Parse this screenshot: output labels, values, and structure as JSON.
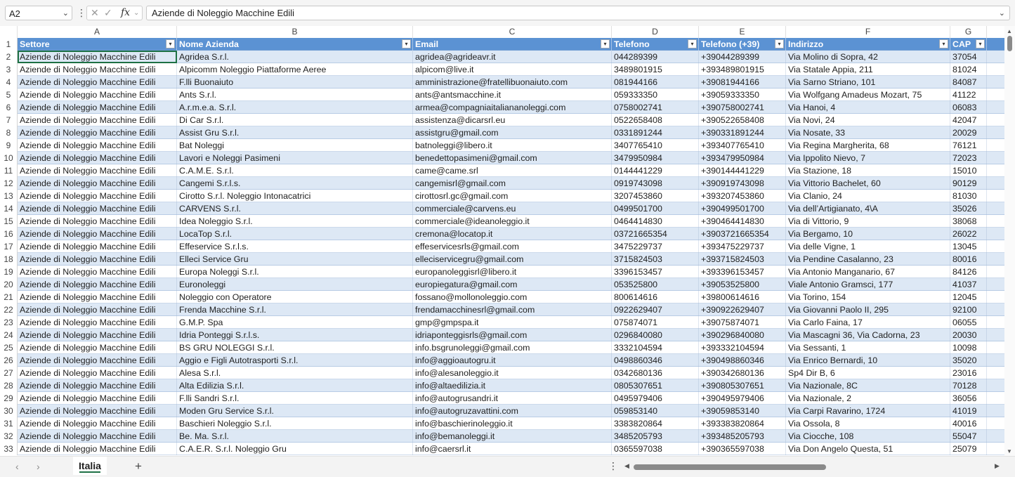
{
  "formula_bar": {
    "name_box": "A2",
    "formula": "Aziende di Noleggio Macchine Edili"
  },
  "columns": [
    "A",
    "B",
    "C",
    "D",
    "E",
    "F",
    "G"
  ],
  "header_row_number": "1",
  "headers": [
    "Settore",
    "Nome Azienda",
    "Email",
    "Telefono",
    "Telefono (+39)",
    "Indirizzo",
    "CAP"
  ],
  "rows": [
    {
      "n": "2",
      "cells": [
        "Aziende di Noleggio Macchine Edili",
        "Agridea S.r.l.",
        "agridea@agrideavr.it",
        "044289399",
        "+39044289399",
        "Via Molino di Sopra, 42",
        "37054"
      ]
    },
    {
      "n": "3",
      "cells": [
        "Aziende di Noleggio Macchine Edili",
        "Alpicomm Noleggio Piattaforme Aeree",
        "alpicom@live.it",
        "3489801915",
        "+393489801915",
        "Via Statale Appia, 211",
        "81024"
      ]
    },
    {
      "n": "4",
      "cells": [
        "Aziende di Noleggio Macchine Edili",
        "F.lli Buonaiuto",
        "amministrazione@fratellibuonaiuto.com",
        "081944166",
        "+39081944166",
        "Via Sarno Striano, 101",
        "84087"
      ]
    },
    {
      "n": "5",
      "cells": [
        "Aziende di Noleggio Macchine Edili",
        "Ants S.r.l.",
        "ants@antsmacchine.it",
        "059333350",
        "+39059333350",
        "Via Wolfgang Amadeus Mozart, 75",
        "41122"
      ]
    },
    {
      "n": "6",
      "cells": [
        "Aziende di Noleggio Macchine Edili",
        "A.r.m.e.a. S.r.l.",
        "armea@compagniaitaliananoleggi.com",
        "0758002741",
        "+390758002741",
        "Via Hanoi, 4",
        "06083"
      ]
    },
    {
      "n": "7",
      "cells": [
        "Aziende di Noleggio Macchine Edili",
        "Di Car S.r.l.",
        "assistenza@dicarsrl.eu",
        "0522658408",
        "+390522658408",
        "Via Novi, 24",
        "42047"
      ]
    },
    {
      "n": "8",
      "cells": [
        "Aziende di Noleggio Macchine Edili",
        "Assist Gru S.r.l.",
        "assistgru@gmail.com",
        "0331891244",
        "+390331891244",
        "Via Nosate, 33",
        "20029"
      ]
    },
    {
      "n": "9",
      "cells": [
        "Aziende di Noleggio Macchine Edili",
        "Bat Noleggi",
        "batnoleggi@libero.it",
        "3407765410",
        "+393407765410",
        "Via Regina Margherita, 68",
        "76121"
      ]
    },
    {
      "n": "10",
      "cells": [
        "Aziende di Noleggio Macchine Edili",
        "Lavori e Noleggi Pasimeni",
        "benedettopasimeni@gmail.com",
        "3479950984",
        "+393479950984",
        "Via Ippolito Nievo, 7",
        "72023"
      ]
    },
    {
      "n": "11",
      "cells": [
        "Aziende di Noleggio Macchine Edili",
        "C.A.M.E. S.r.l.",
        "came@came.srl",
        "0144441229",
        "+390144441229",
        "Via Stazione, 18",
        "15010"
      ]
    },
    {
      "n": "12",
      "cells": [
        "Aziende di Noleggio Macchine Edili",
        "Cangemi S.r.l.s.",
        "cangemisrl@gmail.com",
        "0919743098",
        "+390919743098",
        "Via Vittorio Bachelet, 60",
        "90129"
      ]
    },
    {
      "n": "13",
      "cells": [
        "Aziende di Noleggio Macchine Edili",
        "Cirotto S.r.l. Noleggio Intonacatrici",
        "cirottosrl.gc@gmail.com",
        "3207453860",
        "+393207453860",
        "Via Clanio, 24",
        "81030"
      ]
    },
    {
      "n": "14",
      "cells": [
        "Aziende di Noleggio Macchine Edili",
        "CARVENS S.r.l.",
        "commerciale@carvens.eu",
        "0499501700",
        "+390499501700",
        "Via dell’Artigianato, 4\\A",
        "35026"
      ]
    },
    {
      "n": "15",
      "cells": [
        "Aziende di Noleggio Macchine Edili",
        "Idea Noleggio S.r.l.",
        "commerciale@ideanoleggio.it",
        "0464414830",
        "+390464414830",
        "Via di Vittorio, 9",
        "38068"
      ]
    },
    {
      "n": "16",
      "cells": [
        "Aziende di Noleggio Macchine Edili",
        "LocaTop S.r.l.",
        "cremona@locatop.it",
        "03721665354",
        "+3903721665354",
        "Via Bergamo, 10",
        "26022"
      ]
    },
    {
      "n": "17",
      "cells": [
        "Aziende di Noleggio Macchine Edili",
        "Effeservice S.r.l.s.",
        "effeservicesrls@gmail.com",
        "3475229737",
        "+393475229737",
        "Via delle Vigne, 1",
        "13045"
      ]
    },
    {
      "n": "18",
      "cells": [
        "Aziende di Noleggio Macchine Edili",
        "Elleci Service Gru",
        "elleciservicegru@gmail.com",
        "3715824503",
        "+393715824503",
        "Via Pendine Casalanno, 23",
        "80016"
      ]
    },
    {
      "n": "19",
      "cells": [
        "Aziende di Noleggio Macchine Edili",
        "Europa Noleggi S.r.l.",
        "europanoleggisrl@libero.it",
        "3396153457",
        "+393396153457",
        "Via Antonio Manganario, 67",
        "84126"
      ]
    },
    {
      "n": "20",
      "cells": [
        "Aziende di Noleggio Macchine Edili",
        "Euronoleggi",
        "europiegatura@gmail.com",
        "053525800",
        "+39053525800",
        "Viale Antonio Gramsci, 177",
        "41037"
      ]
    },
    {
      "n": "21",
      "cells": [
        "Aziende di Noleggio Macchine Edili",
        "Noleggio con Operatore",
        "fossano@mollonoleggio.com",
        "800614616",
        "+39800614616",
        "Via Torino, 154",
        "12045"
      ]
    },
    {
      "n": "22",
      "cells": [
        "Aziende di Noleggio Macchine Edili",
        "Frenda Macchine S.r.l.",
        "frendamacchinesrl@gmail.com",
        "0922629407",
        "+390922629407",
        "Via Giovanni Paolo II, 295",
        "92100"
      ]
    },
    {
      "n": "23",
      "cells": [
        "Aziende di Noleggio Macchine Edili",
        "G.M.P. Spa",
        "gmp@gmpspa.it",
        "075874071",
        "+39075874071",
        "Via Carlo Faina, 17",
        "06055"
      ]
    },
    {
      "n": "24",
      "cells": [
        "Aziende di Noleggio Macchine Edili",
        "Idria Ponteggi S.r.l.s.",
        "idriaponteggisrls@gmail.com",
        "0296840080",
        "+390296840080",
        "Via Mascagni 36, Via Cadorna, 23",
        "20030"
      ]
    },
    {
      "n": "25",
      "cells": [
        "Aziende di Noleggio Macchine Edili",
        "BS GRU NOLEGGI S.r.l.",
        "info.bsgrunoleggi@gmail.com",
        "3332104594",
        "+393332104594",
        "Via Sessanti, 1",
        "10098"
      ]
    },
    {
      "n": "26",
      "cells": [
        "Aziende di Noleggio Macchine Edili",
        "Aggio e Figli Autotrasporti S.r.l.",
        "info@aggioautogru.it",
        "0498860346",
        "+390498860346",
        "Via Enrico Bernardi, 10",
        "35020"
      ]
    },
    {
      "n": "27",
      "cells": [
        "Aziende di Noleggio Macchine Edili",
        "Alesa S.r.l.",
        "info@alesanoleggio.it",
        "0342680136",
        "+390342680136",
        "Sp4 Dir B, 6",
        "23016"
      ]
    },
    {
      "n": "28",
      "cells": [
        "Aziende di Noleggio Macchine Edili",
        "Alta Edilizia S.r.l.",
        "info@altaedilizia.it",
        "0805307651",
        "+390805307651",
        "Via Nazionale, 8C",
        "70128"
      ]
    },
    {
      "n": "29",
      "cells": [
        "Aziende di Noleggio Macchine Edili",
        "F.lli Sandri S.r.l.",
        "info@autogrusandri.it",
        "0495979406",
        "+390495979406",
        "Via Nazionale, 2",
        "36056"
      ]
    },
    {
      "n": "30",
      "cells": [
        "Aziende di Noleggio Macchine Edili",
        "Moden Gru Service S.r.l.",
        "info@autogruzavattini.com",
        "059853140",
        "+39059853140",
        "Via Carpi Ravarino, 1724",
        "41019"
      ]
    },
    {
      "n": "31",
      "cells": [
        "Aziende di Noleggio Macchine Edili",
        "Baschieri Noleggio S.r.l.",
        "info@baschierinoleggio.it",
        "3383820864",
        "+393383820864",
        "Via Ossola, 8",
        "40016"
      ]
    },
    {
      "n": "32",
      "cells": [
        "Aziende di Noleggio Macchine Edili",
        "Be. Ma. S.r.l.",
        "info@bemanoleggi.it",
        "3485205793",
        "+393485205793",
        "Via Ciocche, 108",
        "55047"
      ]
    },
    {
      "n": "33",
      "cells": [
        "Aziende di Noleggio Macchine Edili",
        "C.A.E.R. S.r.l. Noleggio Gru",
        "info@caersrl.it",
        "0365597038",
        "+390365597038",
        "Via Don Angelo Questa, 51",
        "25079"
      ]
    }
  ],
  "sheet_tabs": [
    "Italia"
  ],
  "colors": {
    "header_bg": "#5b92d3",
    "band_bg": "#dde8f5",
    "accent": "#1e7145"
  }
}
